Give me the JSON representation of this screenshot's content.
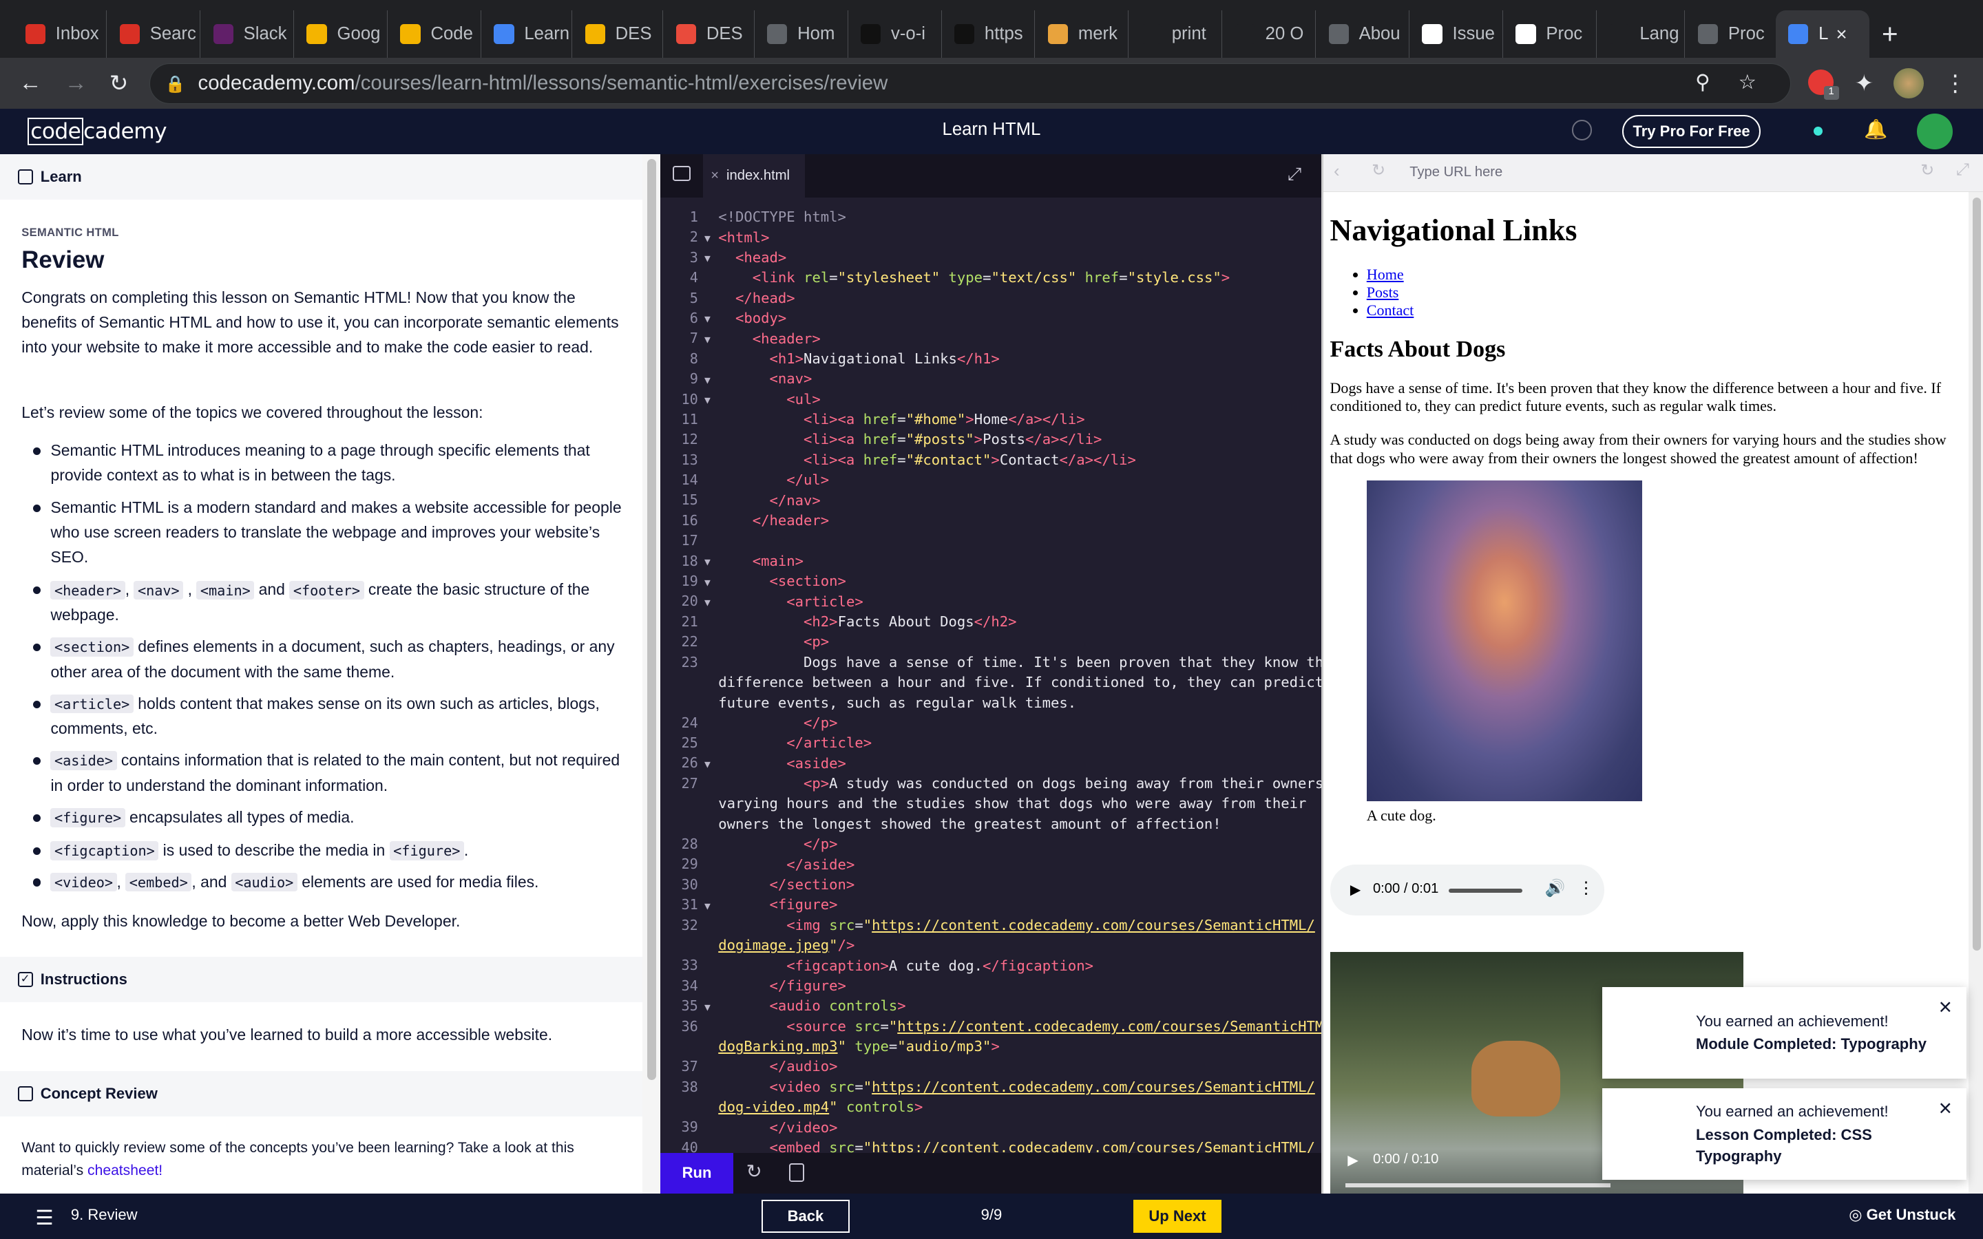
{
  "browser": {
    "tabs": [
      {
        "label": "Inbox",
        "color": "#d93025",
        "icon": "gmail-icon"
      },
      {
        "label": "Searc",
        "color": "#d93025",
        "icon": "gmail-icon"
      },
      {
        "label": "Slack",
        "color": "#611f69",
        "icon": "slack-icon"
      },
      {
        "label": "Goog",
        "color": "#f4b400",
        "icon": "google-slides-icon"
      },
      {
        "label": "Code",
        "color": "#f4b400",
        "icon": "codecademy-icon"
      },
      {
        "label": "Learn",
        "color": "#4285f4",
        "icon": "doc-icon"
      },
      {
        "label": "DES",
        "color": "#f4b400",
        "icon": "codecademy-icon"
      },
      {
        "label": "DES",
        "color": "#e94b3c",
        "icon": "circle-icon"
      },
      {
        "label": "Hom",
        "color": "#5f6368",
        "icon": "globe-icon"
      },
      {
        "label": "v-o-i",
        "color": "#111111",
        "icon": "bar-icon"
      },
      {
        "label": "https",
        "color": "#111111",
        "icon": "bar-icon"
      },
      {
        "label": "merk",
        "color": "#e8a33d",
        "icon": "image-icon"
      },
      {
        "label": "print",
        "color": "#202124",
        "icon": "p-icon"
      },
      {
        "label": "20 O",
        "color": "#202124",
        "icon": "number-icon"
      },
      {
        "label": "Abou",
        "color": "#5f6368",
        "icon": "globe-icon"
      },
      {
        "label": "Issue",
        "color": "#ffffff",
        "icon": "github-icon"
      },
      {
        "label": "Proc",
        "color": "#ffffff",
        "icon": "doc-icon"
      },
      {
        "label": "Lang",
        "color": "#202124",
        "icon": "p-icon"
      },
      {
        "label": "Proc",
        "color": "#5f6368",
        "icon": "globe-icon"
      },
      {
        "label": "L",
        "color": "#4285f4",
        "icon": "doc-icon"
      }
    ],
    "url_host": "codecademy.com",
    "url_path": "/courses/learn-html/lessons/semantic-html/exercises/review",
    "extension_badge": "1"
  },
  "header": {
    "logo_a": "code",
    "logo_b": "cademy",
    "course_title": "Learn HTML",
    "try_pro": "Try Pro For Free"
  },
  "lesson": {
    "section_learn": "Learn",
    "kicker": "SEMANTIC HTML",
    "title": "Review",
    "intro": "Congrats on completing this lesson on Semantic HTML! Now that you know the benefits of Semantic HTML and how to use it, you can incorporate semantic elements into your website to make it more accessible and to make the code easier to read.",
    "review_lead": "Let’s review some of the topics we covered throughout the lesson:",
    "b1": "Semantic HTML introduces meaning to a page through specific elements that provide context as to what is in between the tags.",
    "b2": "Semantic HTML is a modern standard and makes a website accessible for people who use screen readers to translate the webpage and improves your website’s SEO.",
    "b3_rest": " create the basic structure of the webpage.",
    "b4_rest": " defines elements in a document, such as chapters, headings, or any other area of the document with the same theme.",
    "b5_rest": " holds content that makes sense on its own such as articles, blogs, comments, etc.",
    "b6_rest": " contains information that is related to the main content, but not required in order to understand the dominant information.",
    "b7_rest": " encapsulates all types of media.",
    "b8_mid": " is used to describe the media in ",
    "b9_rest": " elements are used for media files.",
    "outro": "Now, apply this knowledge to become a better Web Developer.",
    "section_instructions": "Instructions",
    "instructions_text": "Now it’s time to use what you’ve learned to build a more accessible website.",
    "section_concept": "Concept Review",
    "concept_text": "Want to quickly review some of the concepts you’ve been learning? Take a look at this material’s ",
    "cheatsheet": "cheatsheet!"
  },
  "editor": {
    "file_tab": "index.html",
    "run_label": "Run"
  },
  "preview": {
    "url_placeholder": "Type URL here",
    "h1": "Navigational Links",
    "nav": [
      "Home",
      "Posts",
      "Contact"
    ],
    "h2": "Facts About Dogs",
    "p1": "Dogs have a sense of time. It's been proven that they know the difference between a hour and five. If conditioned to, they can predict future events, such as regular walk times.",
    "p2": "A study was conducted on dogs being away from their owners for varying hours and the studies show that dogs who were away from their owners the longest showed the greatest amount of affection!",
    "caption": "A cute dog.",
    "audio_time": "0:00 / 0:01",
    "video_time": "0:00 / 0:10"
  },
  "toasts": [
    {
      "head": "You earned an achievement!",
      "body": "Module Completed: Typography"
    },
    {
      "head": "You earned an achievement!",
      "body": "Lesson Completed: CSS Typography"
    }
  ],
  "bottom": {
    "exercise": "9. Review",
    "back": "Back",
    "progress": "9/9",
    "up_next": "Up Next",
    "get_unstuck": "Get Unstuck"
  }
}
